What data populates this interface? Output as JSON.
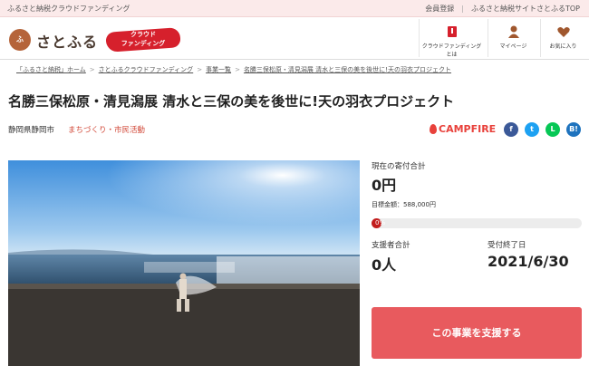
{
  "topbar": {
    "tagline": "ふるさと納税クラウドファンディング",
    "member_register": "会員登録",
    "separator": "|",
    "site_top": "ふるさと納税サイトさとふるTOP"
  },
  "header": {
    "logo_text": "さとふる",
    "cf_badge_line1": "クラウド",
    "cf_badge_line2": "ファンディング",
    "nav": [
      {
        "label": "クラウドファンディングとは",
        "icon": "book-icon"
      },
      {
        "label": "マイページ",
        "icon": "person-icon"
      },
      {
        "label": "お気に入り",
        "icon": "heart-icon"
      }
    ]
  },
  "breadcrumb": [
    "「ふるさと納税」ホーム",
    "さとふるクラウドファンディング",
    "事業一覧",
    "名勝三保松原・清見潟展 清水と三保の美を後世に!天の羽衣プロジェクト"
  ],
  "project": {
    "title": "名勝三保松原・清見潟展 清水と三保の美を後世に!天の羽衣プロジェクト",
    "location": "静岡県静岡市",
    "category": "まちづくり・市民活動",
    "partner": "CAMPFIRE"
  },
  "social": {
    "facebook": "f",
    "twitter": "t",
    "line": "L",
    "hatena": "B!"
  },
  "stats": {
    "current_total_label": "現在の寄付合計",
    "current_total": "0円",
    "goal_label": "目標金額：588,000円",
    "progress_label": "0%",
    "progress_value": 0,
    "supporters_label": "支援者合計",
    "supporters": "0人",
    "deadline_label": "受付終了日",
    "deadline": "2021/6/30"
  },
  "cta": {
    "support_button": "この事業を支援する"
  },
  "colors": {
    "accent": "#e85a5e",
    "brand_red": "#d6202c",
    "campfire": "#e8413b",
    "progress_fill": "#c21d1d"
  }
}
